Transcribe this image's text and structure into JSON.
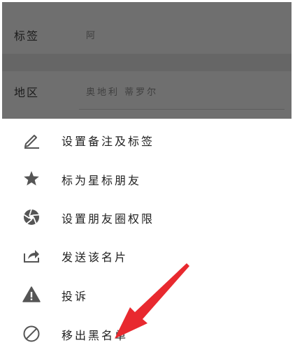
{
  "profile": {
    "rows": [
      {
        "label": "标签",
        "value": "阿"
      },
      {
        "label": "地区",
        "value": "奥地利 蒂罗尔"
      }
    ]
  },
  "menu": {
    "items": [
      {
        "label": "设置备注及标签",
        "icon": "pencil-icon"
      },
      {
        "label": "标为星标朋友",
        "icon": "star-icon"
      },
      {
        "label": "设置朋友圈权限",
        "icon": "aperture-icon"
      },
      {
        "label": "发送该名片",
        "icon": "share-icon"
      },
      {
        "label": "投诉",
        "icon": "warning-icon"
      },
      {
        "label": "移出黑名单",
        "icon": "prohibited-icon"
      }
    ]
  },
  "colors": {
    "dim_background": "#6f6f6f",
    "icon": "#555555",
    "arrow": "#e8292f"
  }
}
